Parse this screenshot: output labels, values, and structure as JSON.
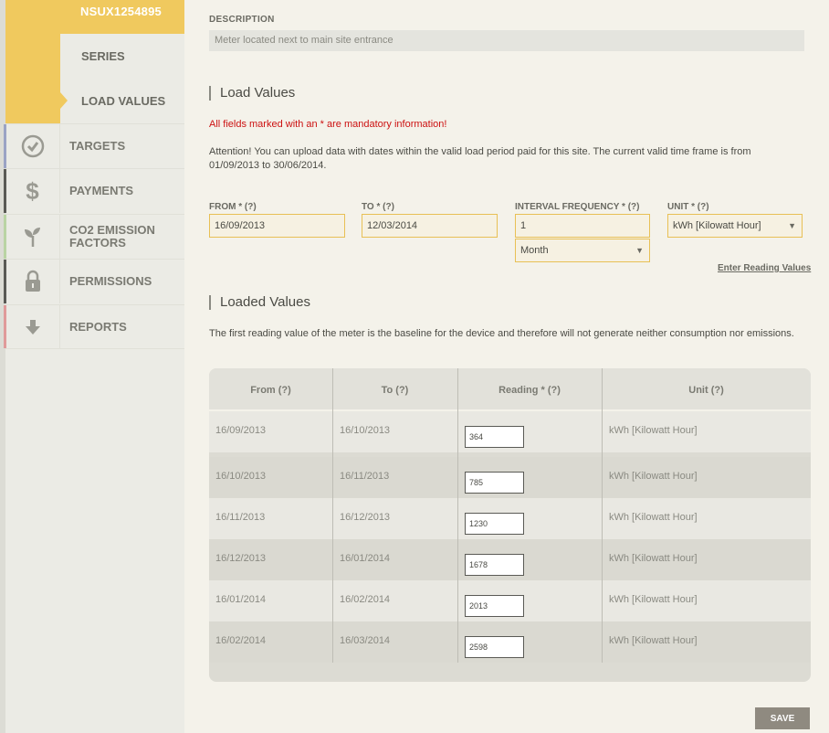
{
  "sidebar": {
    "meter_id": "NSUX1254895",
    "sub_items": [
      {
        "label": "SERIES"
      },
      {
        "label": "LOAD VALUES"
      }
    ],
    "items": [
      {
        "label": "TARGETS",
        "icon": "check-circle-icon",
        "accent": "#9aa3c4"
      },
      {
        "label": "PAYMENTS",
        "icon": "dollar-icon",
        "accent": "#5a5a55"
      },
      {
        "label": "CO2 EMISSION FACTORS",
        "icon": "plant-icon",
        "accent": "#b9d4a3"
      },
      {
        "label": "PERMISSIONS",
        "icon": "lock-icon",
        "accent": "#5a5a55"
      },
      {
        "label": "REPORTS",
        "icon": "arrow-down-icon",
        "accent": "#e09a9a"
      }
    ]
  },
  "description": {
    "label": "DESCRIPTION",
    "value": "Meter located next to main site entrance"
  },
  "load_values": {
    "title": "Load Values",
    "mandatory_text": "All fields marked with an * are mandatory information!",
    "attention_text": "Attention! You can upload data with dates within the valid load period paid for this site. The current valid time frame is from 01/09/2013 to 30/06/2014.",
    "from": {
      "label": "FROM * (?)",
      "value": "16/09/2013"
    },
    "to": {
      "label": "TO * (?)",
      "value": "12/03/2014"
    },
    "interval": {
      "label": "INTERVAL FREQUENCY * (?)",
      "value": "1",
      "period": "Month"
    },
    "unit": {
      "label": "UNIT * (?)",
      "value": "kWh [Kilowatt Hour]"
    },
    "enter_link": "Enter Reading Values"
  },
  "loaded_values": {
    "title": "Loaded Values",
    "note": "The first reading value of the meter is the baseline for the device and therefore will not generate neither consumption nor emissions.",
    "headers": [
      "From (?)",
      "To (?)",
      "Reading * (?)",
      "Unit (?)"
    ],
    "rows": [
      {
        "from": "16/09/2013",
        "to": "16/10/2013",
        "reading": "364",
        "unit": "kWh [Kilowatt Hour]"
      },
      {
        "from": "16/10/2013",
        "to": "16/11/2013",
        "reading": "785",
        "unit": "kWh [Kilowatt Hour]"
      },
      {
        "from": "16/11/2013",
        "to": "16/12/2013",
        "reading": "1230",
        "unit": "kWh [Kilowatt Hour]"
      },
      {
        "from": "16/12/2013",
        "to": "16/01/2014",
        "reading": "1678",
        "unit": "kWh [Kilowatt Hour]"
      },
      {
        "from": "16/01/2014",
        "to": "16/02/2014",
        "reading": "2013",
        "unit": "kWh [Kilowatt Hour]"
      },
      {
        "from": "16/02/2014",
        "to": "16/03/2014",
        "reading": "2598",
        "unit": "kWh [Kilowatt Hour]"
      }
    ]
  },
  "save_label": "SAVE"
}
